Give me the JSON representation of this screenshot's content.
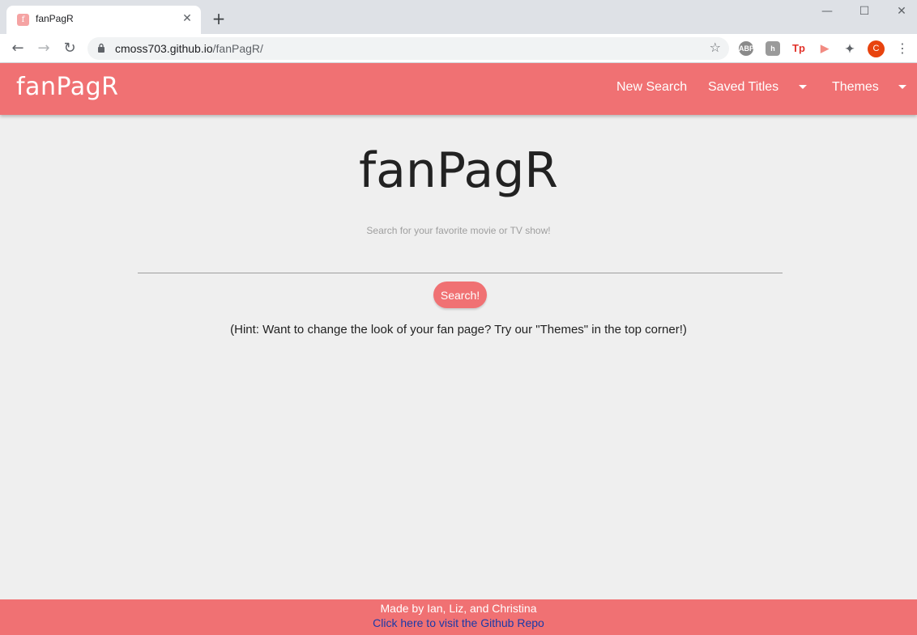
{
  "browser": {
    "tab_title": "fanPagR",
    "favicon_letter": "f",
    "url_host": "cmoss703.github.io",
    "url_path": "/fanPagR/",
    "avatar_letter": "C",
    "extensions": [
      "ABP",
      "h",
      "Tp",
      "▶",
      "puzzle"
    ]
  },
  "nav": {
    "brand": "fanPagR",
    "links": [
      "New Search",
      "Saved Titles",
      "Themes"
    ]
  },
  "hero": {
    "title": "fanPagR",
    "subtitle": "Search for your favorite movie or TV show!",
    "search_button": "Search!",
    "hint": "(Hint: Want to change the look of your fan page? Try our \"Themes\" in the top corner!)"
  },
  "footer": {
    "credit": "Made by Ian, Liz, and Christina",
    "link": "Click here to visit the Github Repo"
  },
  "colors": {
    "accent": "#f07173",
    "background": "#efefef",
    "link": "#1a3aa8"
  }
}
